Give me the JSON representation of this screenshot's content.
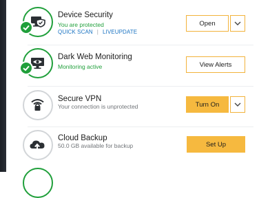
{
  "colors": {
    "accent_green": "#1f9f3a",
    "button_orange": "#f6b93f",
    "link_blue": "#1a73c2"
  },
  "features": [
    {
      "title": "Device Security",
      "status": "You are protected",
      "status_type": "protected",
      "icon": "device-monitor-icon",
      "links": [
        "QUICK SCAN",
        "LIVEUPDATE"
      ],
      "link_separator": "|",
      "action": "Open",
      "has_dropdown": true
    },
    {
      "title": "Dark Web Monitoring",
      "status": "Monitoring active",
      "status_type": "protected",
      "icon": "eye-monitor-icon",
      "action": "View Alerts",
      "has_dropdown": false
    },
    {
      "title": "Secure VPN",
      "status": "Your connection is unprotected",
      "status_type": "unprotected",
      "icon": "wifi-lock-icon",
      "action": "Turn On",
      "has_dropdown": true
    },
    {
      "title": "Cloud Backup",
      "status": "50.0 GB available for backup",
      "status_type": "neutral",
      "icon": "cloud-upload-icon",
      "action": "Set Up",
      "has_dropdown": false
    }
  ]
}
